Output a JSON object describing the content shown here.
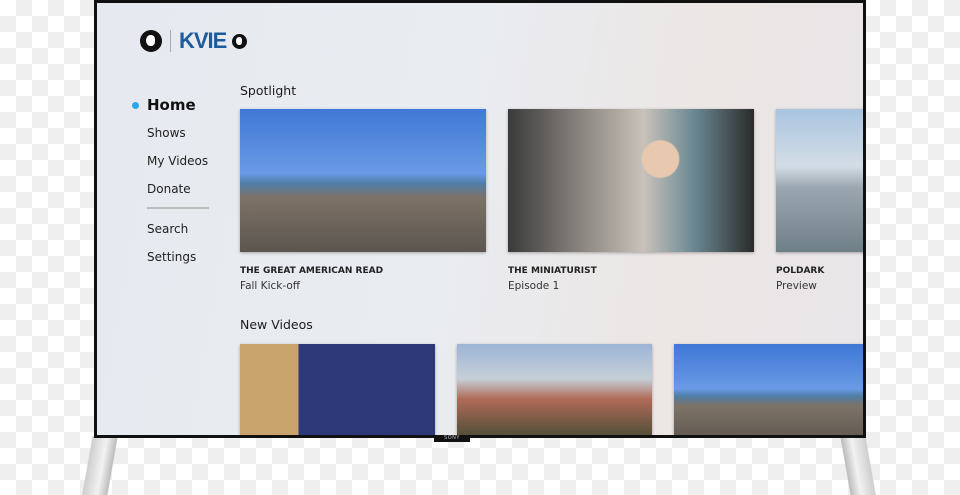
{
  "device": {
    "brand": "SONY"
  },
  "header": {
    "logo_left": "PBS",
    "logo_text": "KVIE"
  },
  "nav": {
    "items": [
      {
        "label": "Home",
        "active": true
      },
      {
        "label": "Shows"
      },
      {
        "label": "My Videos"
      },
      {
        "label": "Donate"
      },
      {
        "label": "Search"
      },
      {
        "label": "Settings"
      }
    ],
    "accent_color": "#2aa7e8"
  },
  "spotlight": {
    "title": "Spotlight",
    "cards": [
      {
        "title": "THE GREAT AMERICAN READ",
        "subtitle": "Fall Kick-off"
      },
      {
        "title": "THE MINIATURIST",
        "subtitle": "Episode 1"
      },
      {
        "title": "POLDARK",
        "subtitle": "Preview"
      }
    ]
  },
  "new_videos": {
    "title": "New Videos"
  }
}
